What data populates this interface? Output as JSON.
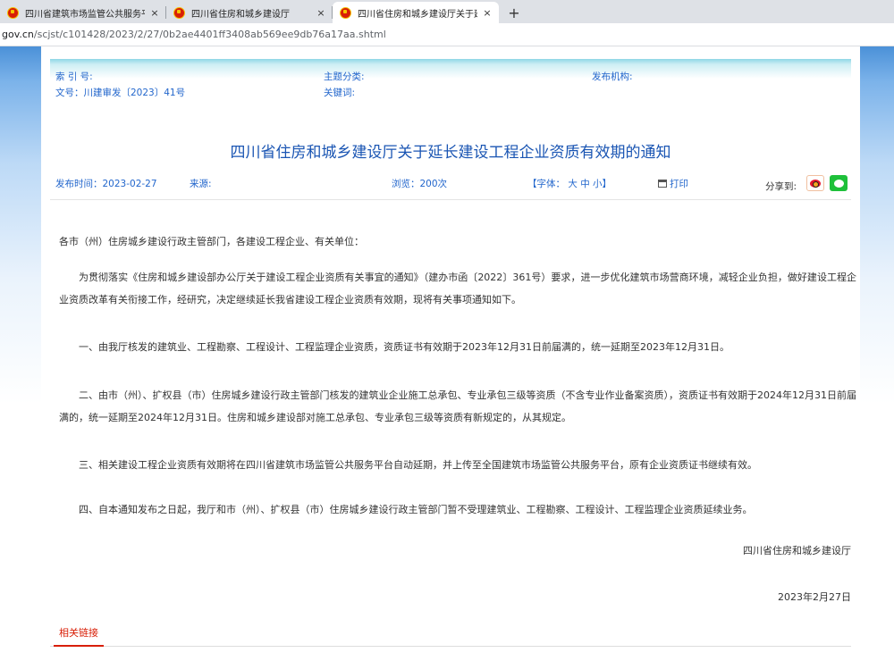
{
  "browser": {
    "tabs": [
      {
        "title": "四川省建筑市场监管公共服务平台",
        "active": false
      },
      {
        "title": "四川省住房和城乡建设厅",
        "active": false
      },
      {
        "title": "四川省住房和城乡建设厅关于延长",
        "active": true
      }
    ],
    "close_glyph": "×",
    "new_tab_glyph": "+",
    "url_host": "gov.cn",
    "url_path": "/scjst/c101428/2023/2/27/0b2ae4401ff3408ab569ee9db76a17aa.shtml"
  },
  "meta": {
    "index_label": "索 引 号:",
    "topic_label": "主题分类:",
    "publisher_label": "发布机构:",
    "doc_no": "文号：川建审发〔2023〕41号",
    "keywords_label": "关键词:"
  },
  "article": {
    "title": "四川省住房和城乡建设厅关于延长建设工程企业资质有效期的通知",
    "publish_time": "发布时间：2023-02-27",
    "source_label": "来源:",
    "views": "浏览：200次",
    "font_label": "【字体：",
    "font_large": "大",
    "font_medium": "中",
    "font_small": "小",
    "font_close": "】",
    "print_label": "打印",
    "share_label": "分享到:",
    "greeting": "各市（州）住房城乡建设行政主管部门，各建设工程企业、有关单位：",
    "paragraphs": [
      "为贯彻落实《住房和城乡建设部办公厅关于建设工程企业资质有关事宜的通知》（建办市函〔2022〕361号）要求，进一步优化建筑市场营商环境，减轻企业负担，做好建设工程企业资质改革有关衔接工作，经研究，决定继续延长我省建设工程企业资质有效期，现将有关事项通知如下。",
      "一、由我厅核发的建筑业、工程勘察、工程设计、工程监理企业资质，资质证书有效期于2023年12月31日前届满的，统一延期至2023年12月31日。",
      "二、由市（州）、扩权县（市）住房城乡建设行政主管部门核发的建筑业企业施工总承包、专业承包三级等资质（不含专业作业备案资质），资质证书有效期于2024年12月31日前届满的，统一延期至2024年12月31日。住房和城乡建设部对施工总承包、专业承包三级等资质有新规定的，从其规定。",
      "三、相关建设工程企业资质有效期将在四川省建筑市场监管公共服务平台自动延期，并上传至全国建筑市场监管公共服务平台，原有企业资质证书继续有效。",
      "四、自本通知发布之日起，我厅和市（州）、扩权县（市）住房城乡建设行政主管部门暂不受理建筑业、工程勘察、工程设计、工程监理企业资质延续业务。"
    ],
    "signature": "四川省住房和城乡建设厅",
    "date": "2023年2月27日",
    "related_links": "相关链接"
  }
}
